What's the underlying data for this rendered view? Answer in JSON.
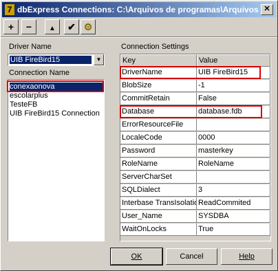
{
  "window": {
    "title": "dbExpress Connections: C:\\Arquivos de programas\\Arquivos ..."
  },
  "toolbar": {
    "icons": [
      "plus-icon",
      "minus-icon",
      "up-arrow-icon",
      "check-icon",
      "gear-icon"
    ]
  },
  "driver": {
    "label": "Driver Name",
    "selected": "UIB FireBird15"
  },
  "connections": {
    "label": "Connection Name",
    "items": [
      "conexaonova",
      "escolarplus",
      "TesteFB",
      "UIB FireBird15 Connection"
    ],
    "selected_index": 0
  },
  "settings": {
    "label": "Connection Settings",
    "headers": [
      "Key",
      "Value"
    ],
    "rows": [
      {
        "key": "DriverName",
        "value": "UIB FireBird15"
      },
      {
        "key": "BlobSize",
        "value": "-1"
      },
      {
        "key": "CommitRetain",
        "value": "False"
      },
      {
        "key": "Database",
        "value": "database.fdb"
      },
      {
        "key": "ErrorResourceFile",
        "value": ""
      },
      {
        "key": "LocaleCode",
        "value": "0000"
      },
      {
        "key": "Password",
        "value": "masterkey"
      },
      {
        "key": "RoleName",
        "value": "RoleName"
      },
      {
        "key": "ServerCharSet",
        "value": ""
      },
      {
        "key": "SQLDialect",
        "value": "3"
      },
      {
        "key": "Interbase TransIsolation",
        "value": "ReadCommited"
      },
      {
        "key": "User_Name",
        "value": "SYSDBA"
      },
      {
        "key": "WaitOnLocks",
        "value": "True"
      }
    ]
  },
  "buttons": {
    "ok": "OK",
    "cancel": "Cancel",
    "help": "Help"
  },
  "colors": {
    "selection": "#0a246a",
    "highlight": "#d40000",
    "face": "#d4d0c8"
  }
}
